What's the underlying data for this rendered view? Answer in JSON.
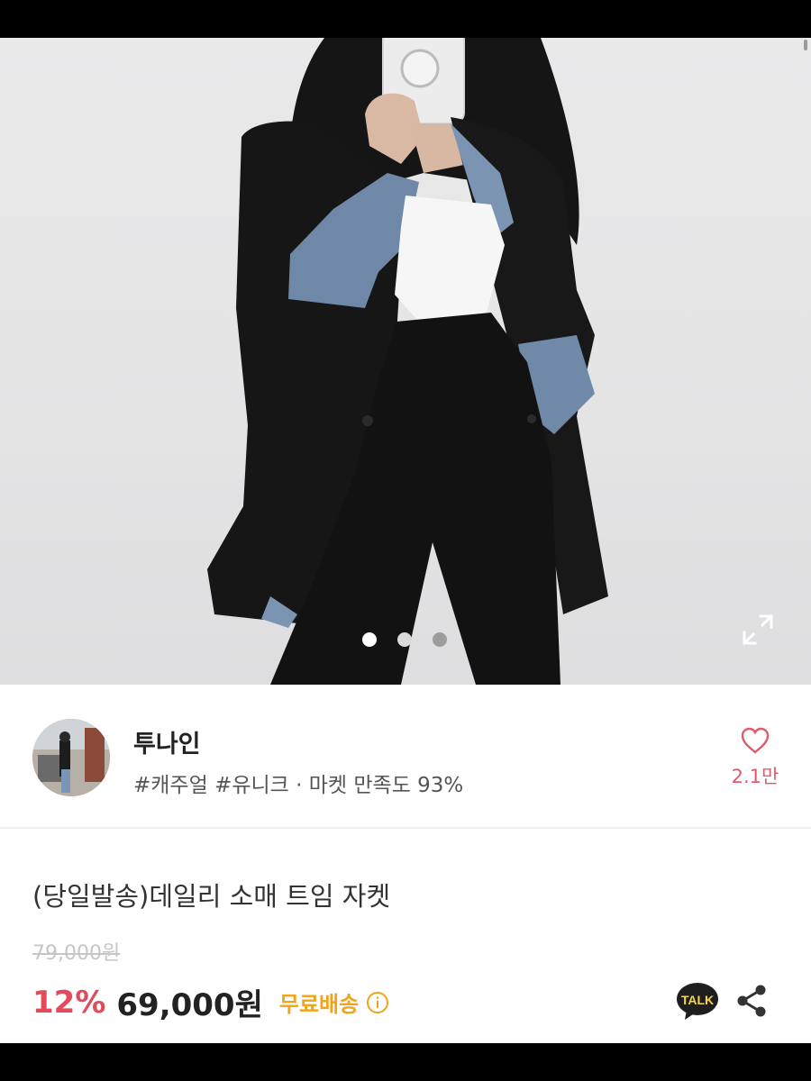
{
  "gallery": {
    "image_description_icon": "product-photo",
    "slide_count": 3,
    "active_slide": 1,
    "expand_icon": "expand-icon"
  },
  "shop": {
    "name": "투나인",
    "tags": "#캐주얼 #유니크 · 마켓 만족도 93%",
    "like_count": "2.1만",
    "like_icon": "heart-icon"
  },
  "product": {
    "title": "(당일발송)데일리 소매 트임 자켓",
    "original_price": "79,000원",
    "discount": "12%",
    "price": "69,000원",
    "shipping": "무료배송",
    "talk_label": "TALK"
  },
  "colors": {
    "discount": "#e34a5c",
    "shipping": "#f0a418",
    "like": "#e05c6c",
    "talk_bg": "#1e1e1e"
  }
}
